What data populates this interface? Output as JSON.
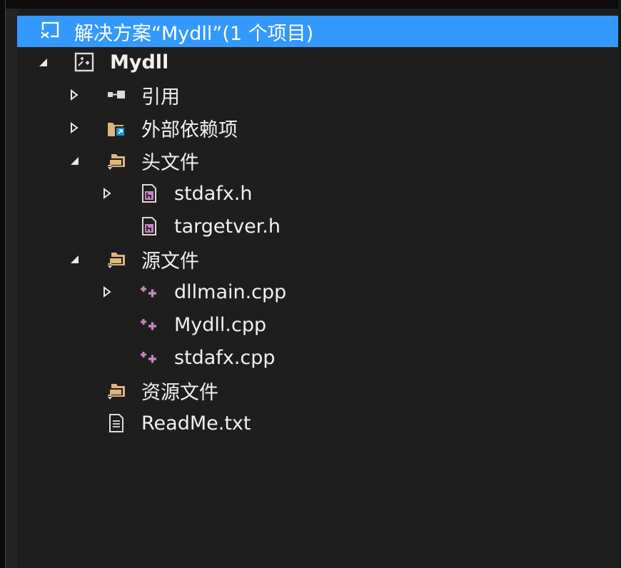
{
  "tree": {
    "solution": {
      "label": "解决方案“Mydll”(1 个项目)"
    },
    "project": {
      "label": "Mydll"
    },
    "references": {
      "label": "引用"
    },
    "external_deps": {
      "label": "外部依赖项"
    },
    "header_files": {
      "label": "头文件",
      "items": [
        "stdafx.h",
        "targetver.h"
      ]
    },
    "source_files": {
      "label": "源文件",
      "items": [
        "dllmain.cpp",
        "Mydll.cpp",
        "stdafx.cpp"
      ]
    },
    "resource_files": {
      "label": "资源文件"
    },
    "readme": {
      "label": "ReadMe.txt"
    }
  },
  "colors": {
    "selection": "#3399ff",
    "folder": "#dcb67a",
    "cpp": "#c586c0",
    "panel": "#1e1e1e"
  }
}
